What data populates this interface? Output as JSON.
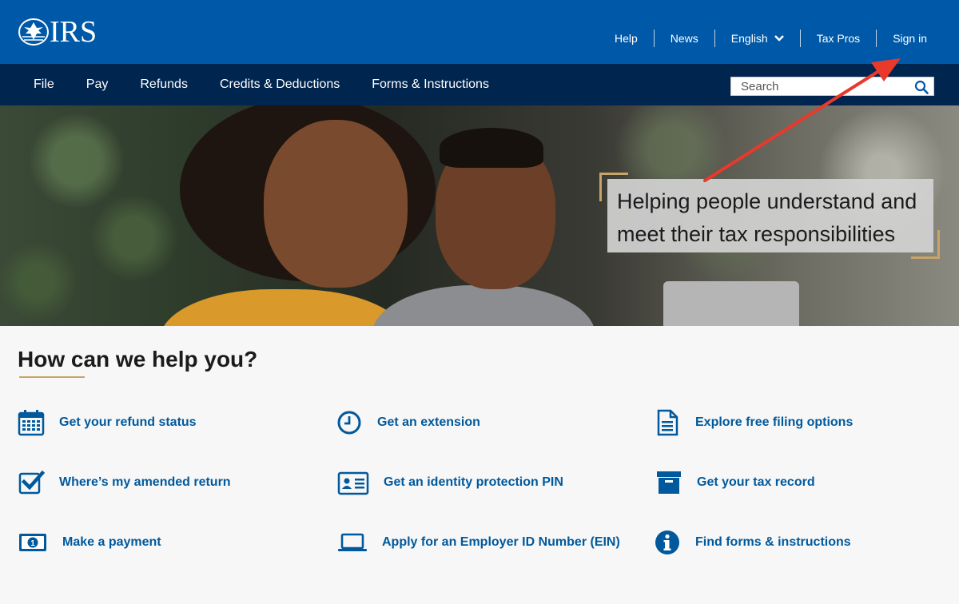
{
  "header": {
    "logo_text": "IRS",
    "utility_links": [
      "Help",
      "News",
      "English",
      "Tax Pros",
      "Sign in"
    ]
  },
  "nav": {
    "items": [
      "File",
      "Pay",
      "Refunds",
      "Credits & Deductions",
      "Forms & Instructions"
    ],
    "search_placeholder": "Search"
  },
  "hero": {
    "line1": "Helping people understand and",
    "line2": "meet their tax responsibilities"
  },
  "help": {
    "title": "How can we help you?",
    "tasks": [
      {
        "label": "Get your refund status",
        "icon": "calendar-icon"
      },
      {
        "label": "Get an extension",
        "icon": "clock-icon"
      },
      {
        "label": "Explore free filing options",
        "icon": "document-icon"
      },
      {
        "label": "Where’s my amended return",
        "icon": "checkbox-icon"
      },
      {
        "label": "Get an identity protection PIN",
        "icon": "id-card-icon"
      },
      {
        "label": "Get your tax record",
        "icon": "archive-box-icon"
      },
      {
        "label": "Make a payment",
        "icon": "dollar-bill-icon"
      },
      {
        "label": "Apply for an Employer ID Number (EIN)",
        "icon": "laptop-icon"
      },
      {
        "label": "Find forms & instructions",
        "icon": "info-icon"
      }
    ]
  },
  "colors": {
    "top_bar": "#0059a8",
    "nav_bar": "#00254f",
    "link_blue": "#00599c",
    "accent_gold": "#c8a468",
    "annotation_red": "#e8392b"
  }
}
